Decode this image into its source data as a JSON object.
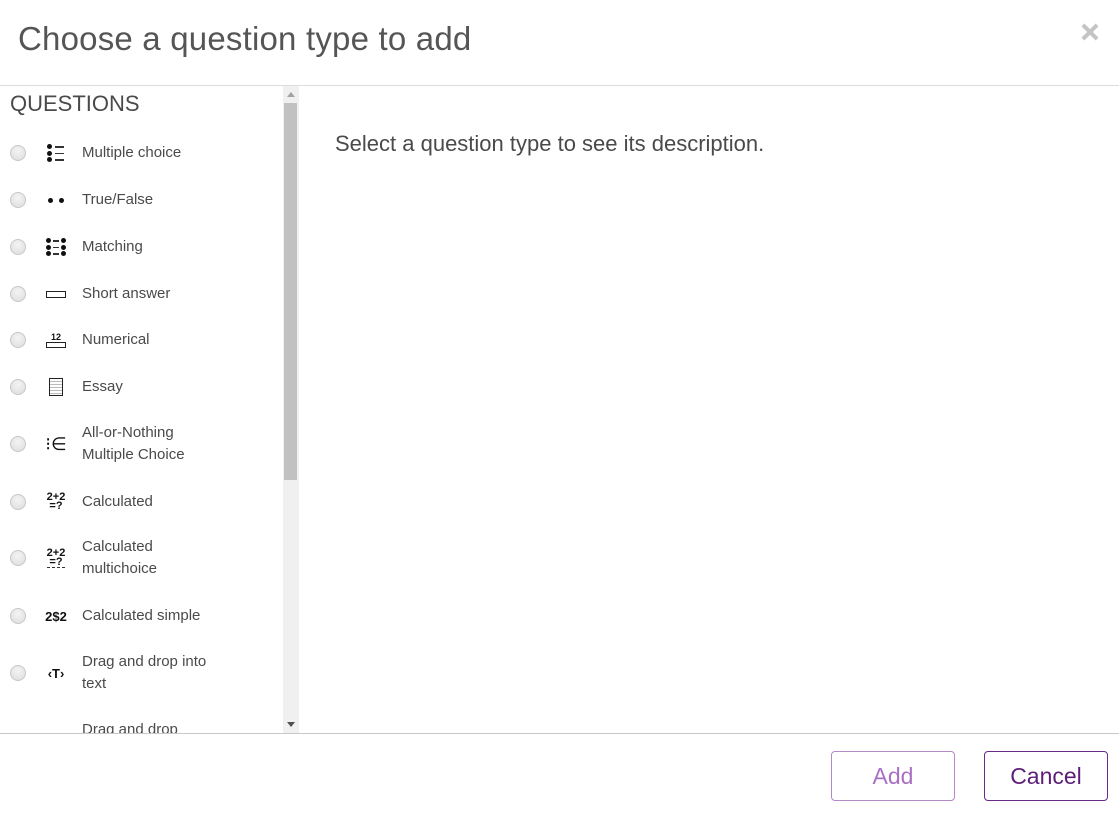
{
  "dialog": {
    "title": "Choose a question type to add",
    "close_icon": "close-icon"
  },
  "left_panel": {
    "section_heading": "QUESTIONS",
    "items": [
      {
        "label": "Multiple choice",
        "icon": "multiple-choice-icon",
        "selected": false
      },
      {
        "label": "True/False",
        "icon": "true-false-icon",
        "selected": false
      },
      {
        "label": "Matching",
        "icon": "matching-icon",
        "selected": false
      },
      {
        "label": "Short answer",
        "icon": "short-answer-icon",
        "selected": false
      },
      {
        "label": "Numerical",
        "icon": "numerical-icon",
        "icon_text": "12",
        "selected": false
      },
      {
        "label": "Essay",
        "icon": "essay-icon",
        "selected": false
      },
      {
        "label": "All-or-Nothing Multiple Choice",
        "icon": "all-or-nothing-icon",
        "icon_text": "⁝∈",
        "selected": false
      },
      {
        "label": "Calculated",
        "icon": "calculated-icon",
        "icon_text_top": "2+2",
        "icon_text_bottom": "=?",
        "selected": false
      },
      {
        "label": "Calculated multichoice",
        "icon": "calculated-multichoice-icon",
        "icon_text_top": "2+2",
        "icon_text_bottom": "=?",
        "selected": false
      },
      {
        "label": "Calculated simple",
        "icon": "calculated-simple-icon",
        "icon_text": "2$2",
        "selected": false
      },
      {
        "label": "Drag and drop into text",
        "icon": "drag-drop-text-icon",
        "icon_text": "‹T›",
        "selected": false
      },
      {
        "label": "Drag and drop",
        "icon": "drag-drop-icon",
        "selected": false
      }
    ]
  },
  "description": {
    "text": "Select a question type to see its description."
  },
  "footer": {
    "add_label": "Add",
    "cancel_label": "Cancel"
  },
  "colors": {
    "add_border": "#b48ac6",
    "add_text": "#a970c4",
    "cancel_border": "#6a2a86",
    "cancel_text": "#5c1e78"
  }
}
